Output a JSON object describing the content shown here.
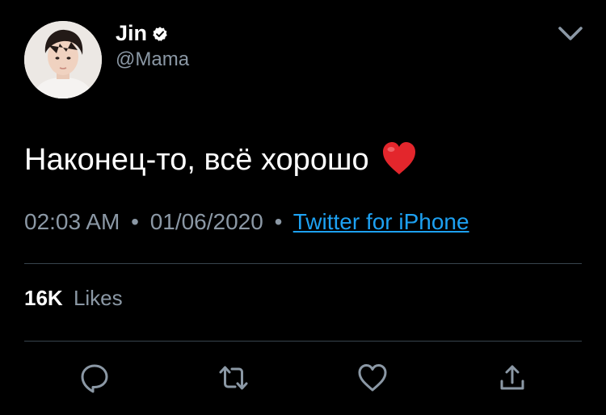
{
  "author": {
    "name": "Jin",
    "handle": "@Mama",
    "verified": true
  },
  "tweet": {
    "text": "Наконец-то, всё хорошо",
    "emoji": "red-heart-emoji"
  },
  "meta": {
    "time": "02:03 AM",
    "separator": "•",
    "date": "01/06/2020",
    "source": "Twitter for iPhone"
  },
  "stats": {
    "likes_count": "16K",
    "likes_label": "Likes"
  },
  "actions": [
    "reply-icon",
    "retweet-icon",
    "like-icon",
    "share-icon"
  ],
  "colors": {
    "background": "#000000",
    "text": "#ffffff",
    "secondary": "#8b98a5",
    "link": "#1da1f2",
    "divider": "#38444d"
  }
}
